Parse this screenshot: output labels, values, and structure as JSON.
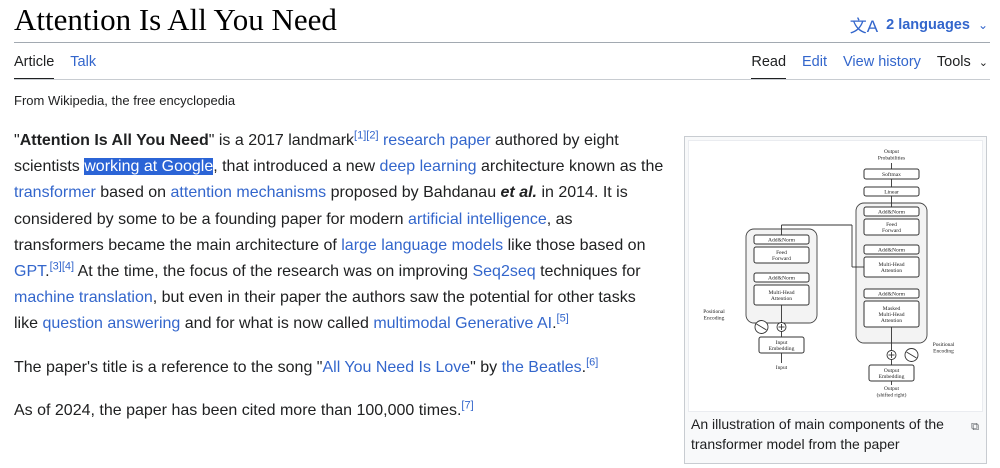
{
  "page": {
    "title": "Attention Is All You Need",
    "languages": "2 languages",
    "tagline": "From Wikipedia, the free encyclopedia"
  },
  "tabs": {
    "article": "Article",
    "talk": "Talk",
    "read": "Read",
    "edit": "Edit",
    "history": "View history",
    "tools": "Tools"
  },
  "body": {
    "p1": {
      "t0": "\"",
      "title_bold": "Attention Is All You Need",
      "t1": "\" is a 2017 landmark",
      "ref1": "[1]",
      "ref2": "[2]",
      "t2": " ",
      "link_research_paper": "research paper",
      "t3": " authored by eight scientists ",
      "selected": "working at Google",
      "t4": ", that introduced a new ",
      "link_deep_learning": "deep learning",
      "t5": " architecture known as the ",
      "link_transformer": "transformer",
      "t6": " based on ",
      "link_attention": "attention mechanisms",
      "t7": " proposed by Bahdanau ",
      "etal": "et al.",
      "t8": " in 2014. It is considered by some to be a founding paper for modern ",
      "link_ai": "artificial intelligence",
      "t9": ", as transformers became the main architecture of ",
      "link_llm": "large language models",
      "t10": " like those based on ",
      "link_gpt": "GPT",
      "ref3": "[3]",
      "ref4": "[4]",
      "t11": " At the time, the focus of the research was on improving ",
      "link_seq2seq": "Seq2seq",
      "t12": " techniques for ",
      "link_mt": "machine translation",
      "t13": ", but even in their paper the authors saw the potential for other tasks like ",
      "link_qa": "question answering",
      "t14": " and for what is now called ",
      "link_mmai": "multimodal Generative AI",
      "t15": ".",
      "ref5": "[5]"
    },
    "p2": {
      "t0": "The paper's title is a reference to the song \"",
      "link_song": "All You Need Is Love",
      "t1": "\" by ",
      "link_beatles": "the Beatles",
      "t2": ".",
      "ref6": "[6]"
    },
    "p3": {
      "t0": "As of 2024, the paper has been cited more than 100,000 times.",
      "ref7": "[7]"
    }
  },
  "figure": {
    "caption": "An illustration of main components of the transformer model from the paper",
    "diagram": {
      "output_probabilities": [
        "Output",
        "Probabilities"
      ],
      "softmax": "Softmax",
      "linear": "Linear",
      "add_norm": "Add&Norm",
      "feed_forward": [
        "Feed",
        "Forward"
      ],
      "multi_head": [
        "Multi-Head",
        "Attention"
      ],
      "masked_multi_head": [
        "Masked",
        "Multi-Head",
        "Attention"
      ],
      "positional_encoding": [
        "Positional",
        "Encoding"
      ],
      "input_embedding": [
        "Input",
        "Embedding"
      ],
      "output_embedding": [
        "Output",
        "Embedding"
      ],
      "inputs": "Input",
      "outputs": [
        "Output",
        "(shifted right)"
      ]
    }
  },
  "icons": {
    "language": "文A",
    "chevron": "⌄",
    "enlarge": "⧉"
  }
}
